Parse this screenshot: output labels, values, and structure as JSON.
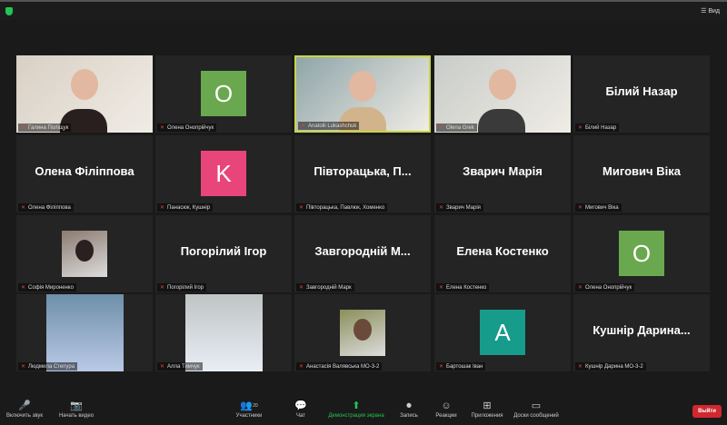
{
  "topbar": {
    "view_label": "Вид",
    "security_icon": "shield-icon"
  },
  "tiles": [
    {
      "kind": "photo",
      "label": "Галина Поліщук",
      "color": "#d9d0c4",
      "accent": "#2a1f1f"
    },
    {
      "kind": "avatar",
      "letter": "O",
      "label": "Олена Онопрійчук",
      "color": "#6aa84f"
    },
    {
      "kind": "photo",
      "label": "Anatolii Lukashchuk",
      "color": "#8fa5a8",
      "accent": "#d2b48c",
      "active": true
    },
    {
      "kind": "photo",
      "label": "Olena Grek",
      "color": "#c8ccc8",
      "accent": "#3a3a3a"
    },
    {
      "kind": "name",
      "big": "Білий Назар",
      "label": "Білий Назар"
    },
    {
      "kind": "name",
      "big": "Олена Філіппова",
      "label": "Олена Філіппова"
    },
    {
      "kind": "avatar",
      "letter": "K",
      "label": "Панасюк, Кушнір",
      "color": "#e8457a"
    },
    {
      "kind": "name",
      "big": "Півторацька,  П...",
      "label": "Півторацька, Павлюк, Хоменко"
    },
    {
      "kind": "name",
      "big": "Зварич Марія",
      "label": "Зварич Марія"
    },
    {
      "kind": "name",
      "big": "Мигович Віка",
      "label": "Мигович Віка"
    },
    {
      "kind": "small",
      "label": "Софія Мироненко",
      "color": "#8a7a70",
      "accent": "#2a2020"
    },
    {
      "kind": "name",
      "big": "Погорілий Ігор",
      "label": "Погорілий Ігор"
    },
    {
      "kind": "name",
      "big": "Завгородній М...",
      "label": "Завгородній Марк"
    },
    {
      "kind": "name",
      "big": "Елена Костенко",
      "label": "Елена Костенко"
    },
    {
      "kind": "avatar",
      "letter": "O",
      "label": "Олена Онопрійчук",
      "color": "#6aa84f"
    },
    {
      "kind": "portrait",
      "label": "Людмила Степура",
      "color": "#6e8fa8",
      "accent": "#b9c9e6"
    },
    {
      "kind": "portrait",
      "label": "Алла Тимчук",
      "color": "#bfc4c4",
      "accent": "#e8eef5"
    },
    {
      "kind": "small",
      "label": "Анастасія Валявська МО-3-2",
      "color": "#8b8f5a",
      "accent": "#6a4a3a"
    },
    {
      "kind": "avatar",
      "letter": "A",
      "label": "Бартошак Іван",
      "color": "#179b8a"
    },
    {
      "kind": "name",
      "big": "Кушнір Дарина...",
      "label": "Кушнір Дарина МО-3-2"
    }
  ],
  "toolbar": {
    "items": [
      {
        "label": "Включить звук",
        "icon": "🎤",
        "name": "unmute-button"
      },
      {
        "label": "Начать видео",
        "icon": "📷",
        "name": "start-video-button"
      },
      {
        "label": "Участники",
        "icon": "👥",
        "count": "20",
        "name": "participants-button"
      },
      {
        "label": "Чат",
        "icon": "💬",
        "name": "chat-button"
      },
      {
        "label": "Демонстрация экрана",
        "icon": "⬆",
        "name": "share-screen-button",
        "green": true
      },
      {
        "label": "Запись",
        "icon": "⏺",
        "name": "record-button"
      },
      {
        "label": "Реакции",
        "icon": "☺",
        "name": "reactions-button"
      },
      {
        "label": "Приложения",
        "icon": "⊞",
        "name": "apps-button"
      },
      {
        "label": "Доски сообщений",
        "icon": "▭",
        "name": "whiteboards-button"
      }
    ],
    "leave_label": "Выйти"
  }
}
